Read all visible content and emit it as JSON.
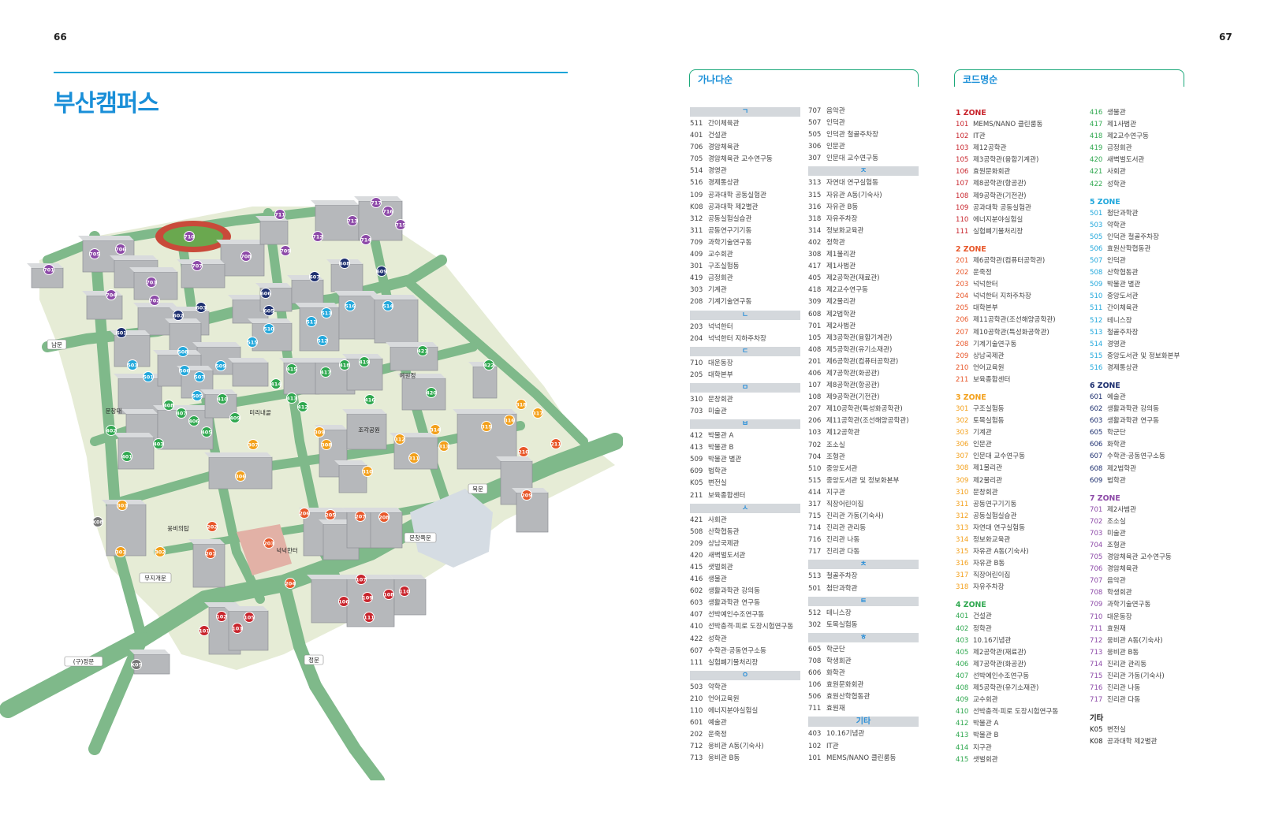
{
  "pages": {
    "left": "66",
    "right": "67"
  },
  "title": "부산캠퍼스",
  "sections": {
    "alpha": "가나다순",
    "code": "코드명순"
  },
  "colors": {
    "zone1": "#c8242c",
    "zone2": "#e8572a",
    "zone3": "#f3a01b",
    "zone4": "#2fa84f",
    "zone5": "#22a8dc",
    "zone6": "#1d2f6f",
    "zone7": "#8d4aa8",
    "other": "#777777"
  },
  "alpha_col1": [
    {
      "letter": "ㄱ",
      "items": [
        [
          "511",
          "간이체육관"
        ],
        [
          "401",
          "건설관"
        ],
        [
          "706",
          "경암체육관"
        ],
        [
          "705",
          "경암체육관 교수연구동"
        ],
        [
          "514",
          "경영관"
        ],
        [
          "516",
          "경제통상관"
        ],
        [
          "109",
          "공과대학 공동실험관"
        ],
        [
          "K08",
          "공과대학 제2별관"
        ],
        [
          "312",
          "공동실험실습관"
        ],
        [
          "311",
          "공동연구기기동"
        ],
        [
          "709",
          "과학기술연구동"
        ],
        [
          "409",
          "교수회관"
        ],
        [
          "301",
          "구조실험동"
        ],
        [
          "419",
          "금정회관"
        ],
        [
          "303",
          "기계관"
        ],
        [
          "208",
          "기계기술연구동"
        ]
      ]
    },
    {
      "letter": "ㄴ",
      "items": [
        [
          "203",
          "넉넉한터"
        ],
        [
          "204",
          "넉넉한터 지하주차장"
        ]
      ]
    },
    {
      "letter": "ㄷ",
      "items": [
        [
          "710",
          "대운동장"
        ],
        [
          "205",
          "대학본부"
        ]
      ]
    },
    {
      "letter": "ㅁ",
      "items": [
        [
          "310",
          "문창회관"
        ],
        [
          "703",
          "미술관"
        ]
      ]
    },
    {
      "letter": "ㅂ",
      "items": [
        [
          "412",
          "박물관 A"
        ],
        [
          "413",
          "박물관 B"
        ],
        [
          "509",
          "박물관 별관"
        ],
        [
          "609",
          "법학관"
        ],
        [
          "K05",
          "변전실"
        ],
        [
          "211",
          "보육종합센터"
        ]
      ]
    },
    {
      "letter": "ㅅ",
      "items": [
        [
          "421",
          "사회관"
        ],
        [
          "508",
          "산학협동관"
        ],
        [
          "209",
          "상남국제관"
        ],
        [
          "420",
          "새벽벌도서관"
        ],
        [
          "415",
          "샛벌회관"
        ],
        [
          "416",
          "생물관"
        ],
        [
          "602",
          "생활과학관 강의동"
        ],
        [
          "603",
          "생활과학관 연구동"
        ],
        [
          "407",
          "선박예인수조연구동"
        ],
        [
          "410",
          "선박충격·피로 도장시험연구동"
        ],
        [
          "422",
          "성학관"
        ],
        [
          "607",
          "수학관·공동연구소동"
        ],
        [
          "111",
          "실험폐기물처리장"
        ]
      ]
    },
    {
      "letter": "ㅇ",
      "items": [
        [
          "503",
          "약학관"
        ],
        [
          "210",
          "언어교육원"
        ],
        [
          "110",
          "에너지분야실험실"
        ],
        [
          "601",
          "예술관"
        ],
        [
          "202",
          "운죽정"
        ],
        [
          "712",
          "웅비관 A동(기숙사)"
        ],
        [
          "713",
          "웅비관 B동"
        ]
      ]
    }
  ],
  "alpha_col2": [
    {
      "letter": "",
      "items": [
        [
          "707",
          "음악관"
        ],
        [
          "507",
          "인덕관"
        ],
        [
          "505",
          "인덕관 철골주차장"
        ],
        [
          "306",
          "인문관"
        ],
        [
          "307",
          "인문대 교수연구동"
        ]
      ]
    },
    {
      "letter": "ㅈ",
      "items": [
        [
          "313",
          "자연대 연구실험동"
        ],
        [
          "315",
          "자유관 A동(기숙사)"
        ],
        [
          "316",
          "자유관 B동"
        ],
        [
          "318",
          "자유주차장"
        ],
        [
          "314",
          "정보화교육관"
        ],
        [
          "402",
          "정학관"
        ],
        [
          "308",
          "제1물리관"
        ],
        [
          "417",
          "제1사범관"
        ],
        [
          "405",
          "제2공학관(재료관)"
        ],
        [
          "418",
          "제2교수연구동"
        ],
        [
          "309",
          "제2물리관"
        ],
        [
          "608",
          "제2법학관"
        ],
        [
          "701",
          "제2사범관"
        ],
        [
          "105",
          "제3공학관(융합기계관)"
        ],
        [
          "408",
          "제5공학관(유기소재관)"
        ],
        [
          "201",
          "제6공학관(컴퓨터공학관)"
        ],
        [
          "406",
          "제7공학관(화공관)"
        ],
        [
          "107",
          "제8공학관(항공관)"
        ],
        [
          "108",
          "제9공학관(기전관)"
        ],
        [
          "207",
          "제10공학관(특성화공학관)"
        ],
        [
          "206",
          "제11공학관(조선해양공학관)"
        ],
        [
          "103",
          "제12공학관"
        ],
        [
          "702",
          "조소실"
        ],
        [
          "704",
          "조형관"
        ],
        [
          "510",
          "중앙도서관"
        ],
        [
          "515",
          "중앙도서관 및 정보화본부"
        ],
        [
          "414",
          "지구관"
        ],
        [
          "317",
          "직장어린이집"
        ],
        [
          "715",
          "진리관 가동(기숙사)"
        ],
        [
          "714",
          "진리관 관리동"
        ],
        [
          "716",
          "진리관 나동"
        ],
        [
          "717",
          "진리관 다동"
        ]
      ]
    },
    {
      "letter": "ㅊ",
      "items": [
        [
          "513",
          "철골주차장"
        ],
        [
          "501",
          "첨단과학관"
        ]
      ]
    },
    {
      "letter": "ㅌ",
      "items": [
        [
          "512",
          "테니스장"
        ],
        [
          "302",
          "토목실험동"
        ]
      ]
    },
    {
      "letter": "ㅎ",
      "items": [
        [
          "605",
          "학군단"
        ],
        [
          "708",
          "학생회관"
        ],
        [
          "606",
          "화학관"
        ],
        [
          "106",
          "효원문화회관"
        ],
        [
          "506",
          "효원산학협동관"
        ],
        [
          "711",
          "효원재"
        ]
      ]
    },
    {
      "letter": "기타",
      "items": [
        [
          "403",
          "10.16기념관"
        ],
        [
          "102",
          "IT관"
        ],
        [
          "101",
          "MEMS/NANO 클린룸동"
        ]
      ]
    }
  ],
  "zones_col1": [
    {
      "name": "1 ZONE",
      "zone": "zone1",
      "items": [
        [
          "101",
          "MEMS/NANO 클린룸동"
        ],
        [
          "102",
          "IT관"
        ],
        [
          "103",
          "제12공학관"
        ],
        [
          "105",
          "제3공학관(융합기계관)"
        ],
        [
          "106",
          "효원문화회관"
        ],
        [
          "107",
          "제8공학관(항공관)"
        ],
        [
          "108",
          "제9공학관(기전관)"
        ],
        [
          "109",
          "공과대학 공동실험관"
        ],
        [
          "110",
          "에너지분야실험실"
        ],
        [
          "111",
          "실험폐기물처리장"
        ]
      ]
    },
    {
      "name": "2 ZONE",
      "zone": "zone2",
      "items": [
        [
          "201",
          "제6공학관(컴퓨터공학관)"
        ],
        [
          "202",
          "운죽정"
        ],
        [
          "203",
          "넉넉한터"
        ],
        [
          "204",
          "넉넉한터 지하주차장"
        ],
        [
          "205",
          "대학본부"
        ],
        [
          "206",
          "제11공학관(조선해양공학관)"
        ],
        [
          "207",
          "제10공학관(특성화공학관)"
        ],
        [
          "208",
          "기계기술연구동"
        ],
        [
          "209",
          "상남국제관"
        ],
        [
          "210",
          "언어교육원"
        ],
        [
          "211",
          "보육종합센터"
        ]
      ]
    },
    {
      "name": "3 ZONE",
      "zone": "zone3",
      "items": [
        [
          "301",
          "구조실험동"
        ],
        [
          "302",
          "토목실험동"
        ],
        [
          "303",
          "기계관"
        ],
        [
          "306",
          "인문관"
        ],
        [
          "307",
          "인문대 교수연구동"
        ],
        [
          "308",
          "제1물리관"
        ],
        [
          "309",
          "제2물리관"
        ],
        [
          "310",
          "문창회관"
        ],
        [
          "311",
          "공동연구기기동"
        ],
        [
          "312",
          "공동실험실습관"
        ],
        [
          "313",
          "자연대 연구실험동"
        ],
        [
          "314",
          "정보화교육관"
        ],
        [
          "315",
          "자유관 A동(기숙사)"
        ],
        [
          "316",
          "자유관 B동"
        ],
        [
          "317",
          "직장어린이집"
        ],
        [
          "318",
          "자유주차장"
        ]
      ]
    },
    {
      "name": "4 ZONE",
      "zone": "zone4",
      "items": [
        [
          "401",
          "건설관"
        ],
        [
          "402",
          "정학관"
        ],
        [
          "403",
          "10.16기념관"
        ],
        [
          "405",
          "제2공학관(재료관)"
        ],
        [
          "406",
          "제7공학관(화공관)"
        ],
        [
          "407",
          "선박예인수조연구동"
        ],
        [
          "408",
          "제5공학관(유기소재관)"
        ],
        [
          "409",
          "교수회관"
        ],
        [
          "410",
          "선박충격·피로 도장시험연구동"
        ],
        [
          "412",
          "박물관 A"
        ],
        [
          "413",
          "박물관 B"
        ],
        [
          "414",
          "지구관"
        ],
        [
          "415",
          "샛벌회관"
        ]
      ]
    }
  ],
  "zones_col2": [
    {
      "name": "",
      "zone": "zone4",
      "items": [
        [
          "416",
          "생물관"
        ],
        [
          "417",
          "제1사범관"
        ],
        [
          "418",
          "제2교수연구동"
        ],
        [
          "419",
          "금정회관"
        ],
        [
          "420",
          "새벽벌도서관"
        ],
        [
          "421",
          "사회관"
        ],
        [
          "422",
          "성학관"
        ]
      ]
    },
    {
      "name": "5 ZONE",
      "zone": "zone5",
      "items": [
        [
          "501",
          "첨단과학관"
        ],
        [
          "503",
          "약학관"
        ],
        [
          "505",
          "인덕관 철골주차장"
        ],
        [
          "506",
          "효원산학협동관"
        ],
        [
          "507",
          "인덕관"
        ],
        [
          "508",
          "산학협동관"
        ],
        [
          "509",
          "박물관 별관"
        ],
        [
          "510",
          "중앙도서관"
        ],
        [
          "511",
          "간이체육관"
        ],
        [
          "512",
          "테니스장"
        ],
        [
          "513",
          "철골주차장"
        ],
        [
          "514",
          "경영관"
        ],
        [
          "515",
          "중앙도서관 및 정보화본부"
        ],
        [
          "516",
          "경제통상관"
        ]
      ]
    },
    {
      "name": "6 ZONE",
      "zone": "zone6",
      "items": [
        [
          "601",
          "예술관"
        ],
        [
          "602",
          "생활과학관 강의동"
        ],
        [
          "603",
          "생활과학관 연구동"
        ],
        [
          "605",
          "학군단"
        ],
        [
          "606",
          "화학관"
        ],
        [
          "607",
          "수학관·공동연구소동"
        ],
        [
          "608",
          "제2법학관"
        ],
        [
          "609",
          "법학관"
        ]
      ]
    },
    {
      "name": "7 ZONE",
      "zone": "zone7",
      "items": [
        [
          "701",
          "제2사범관"
        ],
        [
          "702",
          "조소실"
        ],
        [
          "703",
          "미술관"
        ],
        [
          "704",
          "조형관"
        ],
        [
          "705",
          "경암체육관 교수연구동"
        ],
        [
          "706",
          "경암체육관"
        ],
        [
          "707",
          "음악관"
        ],
        [
          "708",
          "학생회관"
        ],
        [
          "709",
          "과학기술연구동"
        ],
        [
          "710",
          "대운동장"
        ],
        [
          "711",
          "효원재"
        ],
        [
          "712",
          "웅비관 A동(기숙사)"
        ],
        [
          "713",
          "웅비관 B동"
        ],
        [
          "714",
          "진리관 관리동"
        ],
        [
          "715",
          "진리관 가동(기숙사)"
        ],
        [
          "716",
          "진리관 나동"
        ],
        [
          "717",
          "진리관 다동"
        ]
      ]
    }
  ],
  "etc": {
    "title": "기타",
    "items": [
      [
        "K05",
        "변전실"
      ],
      [
        "K08",
        "공과대학 제2별관"
      ]
    ]
  },
  "map": {
    "gates": [
      "남문",
      "문창대",
      "미리내골",
      "조각공원",
      "예원정",
      "북문",
      "웅비의탑",
      "무지개문",
      "넉넉한터",
      "문창쪽문",
      "(구)정문",
      "정문"
    ],
    "pins": [
      [
        "701",
        "zone7"
      ],
      [
        "705",
        "zone7"
      ],
      [
        "706",
        "zone7"
      ],
      [
        "711",
        "zone7"
      ],
      [
        "710",
        "zone7"
      ],
      [
        "712",
        "zone7"
      ],
      [
        "713",
        "zone7"
      ],
      [
        "717",
        "zone7"
      ],
      [
        "716",
        "zone7"
      ],
      [
        "715",
        "zone7"
      ],
      [
        "714",
        "zone7"
      ],
      [
        "708",
        "zone7"
      ],
      [
        "709",
        "zone7"
      ],
      [
        "707",
        "zone7"
      ],
      [
        "703",
        "zone7"
      ],
      [
        "704",
        "zone7"
      ],
      [
        "702",
        "zone7"
      ],
      [
        "608",
        "zone6"
      ],
      [
        "609",
        "zone6"
      ],
      [
        "607",
        "zone6"
      ],
      [
        "606",
        "zone6"
      ],
      [
        "605",
        "zone6"
      ],
      [
        "603",
        "zone6"
      ],
      [
        "602",
        "zone6"
      ],
      [
        "601",
        "zone6"
      ],
      [
        "516",
        "zone5"
      ],
      [
        "514",
        "zone5"
      ],
      [
        "513",
        "zone5"
      ],
      [
        "511",
        "zone5"
      ],
      [
        "512",
        "zone5"
      ],
      [
        "510",
        "zone5"
      ],
      [
        "515",
        "zone5"
      ],
      [
        "508",
        "zone5"
      ],
      [
        "509",
        "zone5"
      ],
      [
        "503",
        "zone5"
      ],
      [
        "506",
        "zone5"
      ],
      [
        "507",
        "zone5"
      ],
      [
        "501",
        "zone5"
      ],
      [
        "505",
        "zone5"
      ],
      [
        "421",
        "zone4"
      ],
      [
        "422",
        "zone4"
      ],
      [
        "415",
        "zone4"
      ],
      [
        "417",
        "zone4"
      ],
      [
        "418",
        "zone4"
      ],
      [
        "419",
        "zone4"
      ],
      [
        "414",
        "zone4"
      ],
      [
        "413",
        "zone4"
      ],
      [
        "412",
        "zone4"
      ],
      [
        "416",
        "zone4"
      ],
      [
        "420",
        "zone4"
      ],
      [
        "410",
        "zone4"
      ],
      [
        "408",
        "zone4"
      ],
      [
        "407",
        "zone4"
      ],
      [
        "406",
        "zone4"
      ],
      [
        "405",
        "zone4"
      ],
      [
        "409",
        "zone4"
      ],
      [
        "402",
        "zone4"
      ],
      [
        "403",
        "zone4"
      ],
      [
        "401",
        "zone4"
      ],
      [
        "318",
        "zone3"
      ],
      [
        "317",
        "zone3"
      ],
      [
        "316",
        "zone3"
      ],
      [
        "315",
        "zone3"
      ],
      [
        "314",
        "zone3"
      ],
      [
        "313",
        "zone3"
      ],
      [
        "312",
        "zone3"
      ],
      [
        "311",
        "zone3"
      ],
      [
        "310",
        "zone3"
      ],
      [
        "309",
        "zone3"
      ],
      [
        "308",
        "zone3"
      ],
      [
        "307",
        "zone3"
      ],
      [
        "306",
        "zone3"
      ],
      [
        "303",
        "zone3"
      ],
      [
        "302",
        "zone3"
      ],
      [
        "301",
        "zone3"
      ],
      [
        "210",
        "zone2"
      ],
      [
        "211",
        "zone2"
      ],
      [
        "209",
        "zone2"
      ],
      [
        "208",
        "zone2"
      ],
      [
        "207",
        "zone2"
      ],
      [
        "206",
        "zone2"
      ],
      [
        "205",
        "zone2"
      ],
      [
        "203",
        "zone2"
      ],
      [
        "202",
        "zone2"
      ],
      [
        "201",
        "zone2"
      ],
      [
        "204",
        "zone2"
      ],
      [
        "107",
        "zone1"
      ],
      [
        "110",
        "zone1"
      ],
      [
        "108",
        "zone1"
      ],
      [
        "109",
        "zone1"
      ],
      [
        "106",
        "zone1"
      ],
      [
        "111",
        "zone1"
      ],
      [
        "105",
        "zone1"
      ],
      [
        "102",
        "zone1"
      ],
      [
        "103",
        "zone1"
      ],
      [
        "101",
        "zone1"
      ],
      [
        "K08",
        "other"
      ],
      [
        "K05",
        "other"
      ]
    ]
  }
}
